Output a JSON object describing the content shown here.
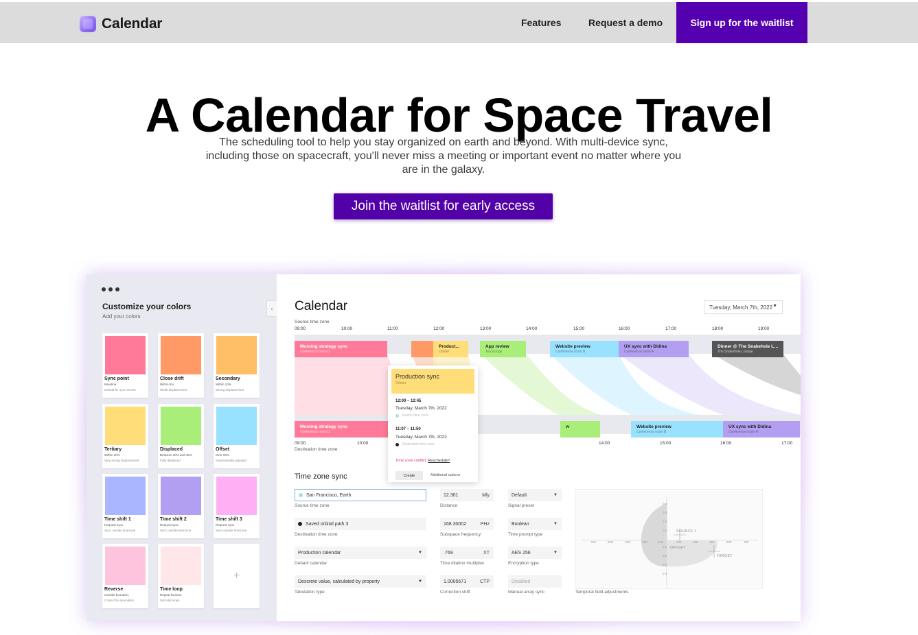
{
  "header": {
    "logo_text": "Calendar",
    "nav": [
      "Features",
      "Request a demo"
    ],
    "cta": "Sign up for the waitlist"
  },
  "hero": {
    "title": "A Calendar for Space Travel",
    "subtitle": "The scheduling tool to help you stay organized on earth and beyond. With multi-device sync, including those on spacecraft, you'll never miss a meeting or important event no matter where you are in the galaxy.",
    "cta": "Join the waitlist for early access"
  },
  "mockup": {
    "sidebar": {
      "title": "Customize your colors",
      "subtitle": "Add your colors",
      "collapse_glyph": "‹",
      "add_glyph": "+",
      "swatches": [
        {
          "name": "Sync point",
          "line1": "Baseline",
          "line2": "Default for sync events",
          "color": "#ff7a98"
        },
        {
          "name": "Close drift",
          "line1": "Within 5%",
          "line2": "Weak displacement",
          "color": "#ff9966"
        },
        {
          "name": "Secondary",
          "line1": "Within 10%",
          "line2": "Strong displacement",
          "color": "#ffbf66"
        },
        {
          "name": "Tertiary",
          "line1": "Within 20%",
          "line2": "Very strong displacement",
          "color": "#ffde7a"
        },
        {
          "name": "Displaced",
          "line1": "Between 30% and 45%",
          "line2": "Fully displaced",
          "color": "#aaee7a"
        },
        {
          "name": "Offset",
          "line1": "Over 60%",
          "line2": "Automatically adjusted",
          "color": "#99e2ff"
        },
        {
          "name": "Time shift 1",
          "line1": "Request sync",
          "line2": "Sync outside timezone",
          "color": "#aab6ff"
        },
        {
          "name": "Time shift 2",
          "line1": "Request sync",
          "line2": "Sync outside timezone",
          "color": "#b39ff2"
        },
        {
          "name": "Time shift 3",
          "line1": "Request sync",
          "line2": "Sync outside timezone",
          "color": "#ffb0f5"
        },
        {
          "name": "Reverse",
          "line1": "Outside boundary",
          "line2": "Correct for anomalies",
          "color": "#ffc4dd"
        },
        {
          "name": "Time loop",
          "line1": "Repeat function",
          "line2": "Set total loops",
          "color": "#ffe6e8"
        }
      ]
    },
    "calendar": {
      "title": "Calendar",
      "date": "Tuesday, March 7th, 2022",
      "source_label": "Source time zone",
      "dest_label": "Destination time zone",
      "source_ticks": [
        "09:00",
        "10:00",
        "11:00",
        "12:00",
        "13:00",
        "14:00",
        "15:00",
        "16:00",
        "17:00",
        "18:00",
        "19:00"
      ],
      "dest_ticks": [
        "09:00",
        "10:00",
        "11:00",
        "14:00",
        "15:00",
        "16:00",
        "17:00"
      ],
      "top_events": [
        {
          "title": "Morning strategy sync",
          "sub": "Conference room D",
          "color": "#ff7a98"
        },
        {
          "title": "",
          "sub": "",
          "color": "#ff9966"
        },
        {
          "title": "Product...",
          "sub": "Orbiter",
          "color": "#ffde7a"
        },
        {
          "title": "App review",
          "sub": "Tea lounge",
          "color": "#aaee7a"
        },
        {
          "title": "Website preview",
          "sub": "Conference room B",
          "color": "#99e2ff"
        },
        {
          "title": "UX sync with Didina",
          "sub": "Conference room A",
          "color": "#b39ff2"
        },
        {
          "title": "Dinner @ The Snakehole Lo...",
          "sub": "The Snakehole Lounge",
          "color": "#555555"
        }
      ],
      "bottom_events": [
        {
          "title": "Morning strategy sync",
          "sub": "Conference room D",
          "color": "#ff7a98"
        },
        {
          "title": "",
          "sub": "",
          "color": "#ffde7a"
        },
        {
          "title": "w",
          "sub": "",
          "color": "#aaee7a"
        },
        {
          "title": "Website preview",
          "sub": "Conference room B",
          "color": "#99e2ff"
        },
        {
          "title": "UX sync with Didina",
          "sub": "Conference room A",
          "color": "#b39ff2"
        }
      ],
      "popup": {
        "title": "Production sync",
        "sub": "Orbiter",
        "time1": "12:00 – 12:45",
        "date1": "Tuesday, March 7th, 2022",
        "tz1": "Source time zone",
        "time2": "11:07 – 11:50",
        "date2": "Tuesday, March 7th, 2022",
        "tz2": "Destination time zone",
        "conflict": "Time zone conflict.",
        "reschedule": "Reschedule?",
        "create": "Create",
        "more": "Additional options"
      }
    },
    "sync": {
      "title": "Time zone sync",
      "fields": [
        {
          "value": "San Francisco, Earth",
          "label": "Source time zone"
        },
        {
          "value": "Saved orbital path 3",
          "label": "Destination time zone"
        },
        {
          "value": "Production calendar",
          "label": "Default calendar"
        },
        {
          "value": "Descrete value, calculated by property",
          "label": "Tabulation type"
        }
      ],
      "numeric": [
        {
          "value": "12.301",
          "unit": "Mly",
          "label": "Distance"
        },
        {
          "value": "168.30002",
          "unit": "PHz",
          "label": "Subspace frequency"
        },
        {
          "value": ".769",
          "unit": "XT",
          "label": "Time dilation multiplier"
        },
        {
          "value": "1.0005671",
          "unit": "CTP",
          "label": "Correction shift"
        }
      ],
      "selects": [
        {
          "value": "Default",
          "label": "Signal preset"
        },
        {
          "value": "Boolean",
          "label": "Time prompt type"
        },
        {
          "value": "AES 256",
          "label": "Encryption type"
        },
        {
          "value": "Disabled",
          "label": "Manual array sync"
        }
      ],
      "graph": {
        "label": "Temporal field adjustments",
        "x_ticks": [
          "-750",
          "-600",
          "-450",
          "-300",
          "-150",
          "150",
          "300",
          "450",
          "600",
          "750"
        ],
        "y_ticks": [
          "0.4",
          "0.3",
          "0.2",
          "0.1",
          "0.1",
          "0.2",
          "0.3",
          "0.4"
        ],
        "source": "SOURCE 1",
        "offset": "OFFSET",
        "target": "TARGET"
      }
    }
  }
}
